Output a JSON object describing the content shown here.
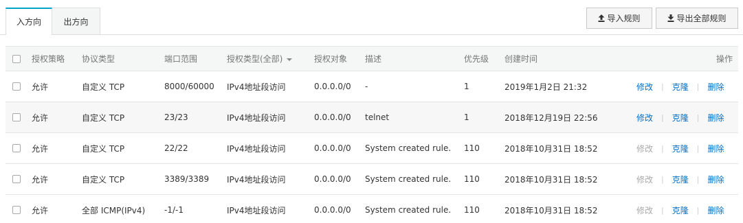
{
  "tabs": [
    {
      "label": "入方向",
      "active": true
    },
    {
      "label": "出方向",
      "active": false
    }
  ],
  "toolbar": {
    "import_label": "导入规则",
    "export_label": "导出全部规则",
    "import_icon": "upload-icon",
    "export_icon": "download-icon"
  },
  "table": {
    "headers": {
      "policy": "授权策略",
      "protocol": "协议类型",
      "port": "端口范围",
      "auth_type": "授权类型(全部)",
      "object": "授权对象",
      "desc": "描述",
      "priority": "优先级",
      "created": "创建时间",
      "ops": "操作"
    },
    "rows": [
      {
        "policy": "允许",
        "protocol": "自定义 TCP",
        "port": "8000/60000",
        "auth_type": "IPv4地址段访问",
        "object": "0.0.0.0/0",
        "desc": "-",
        "priority": "1",
        "created": "2019年1月2日 21:32",
        "edit": "修改",
        "clone": "克隆",
        "delete": "删除",
        "edit_enabled": true
      },
      {
        "policy": "允许",
        "protocol": "自定义 TCP",
        "port": "23/23",
        "auth_type": "IPv4地址段访问",
        "object": "0.0.0.0/0",
        "desc": "telnet",
        "priority": "1",
        "created": "2018年12月19日 22:56",
        "edit": "修改",
        "clone": "克隆",
        "delete": "删除",
        "edit_enabled": true
      },
      {
        "policy": "允许",
        "protocol": "自定义 TCP",
        "port": "22/22",
        "auth_type": "IPv4地址段访问",
        "object": "0.0.0.0/0",
        "desc": "System created rule.",
        "priority": "110",
        "created": "2018年10月31日 18:52",
        "edit": "修改",
        "clone": "克隆",
        "delete": "删除",
        "edit_enabled": false
      },
      {
        "policy": "允许",
        "protocol": "自定义 TCP",
        "port": "3389/3389",
        "auth_type": "IPv4地址段访问",
        "object": "0.0.0.0/0",
        "desc": "System created rule.",
        "priority": "110",
        "created": "2018年10月31日 18:52",
        "edit": "修改",
        "clone": "克隆",
        "delete": "删除",
        "edit_enabled": false
      },
      {
        "policy": "允许",
        "protocol": "全部 ICMP(IPv4)",
        "port": "-1/-1",
        "auth_type": "IPv4地址段访问",
        "object": "0.0.0.0/0",
        "desc": "System created rule.",
        "priority": "110",
        "created": "2018年10月31日 18:52",
        "edit": "修改",
        "clone": "克隆",
        "delete": "删除",
        "edit_enabled": false
      }
    ]
  },
  "colors": {
    "accent": "#00a2ca",
    "link": "#0070cc",
    "disabled": "#aaaaaa"
  }
}
